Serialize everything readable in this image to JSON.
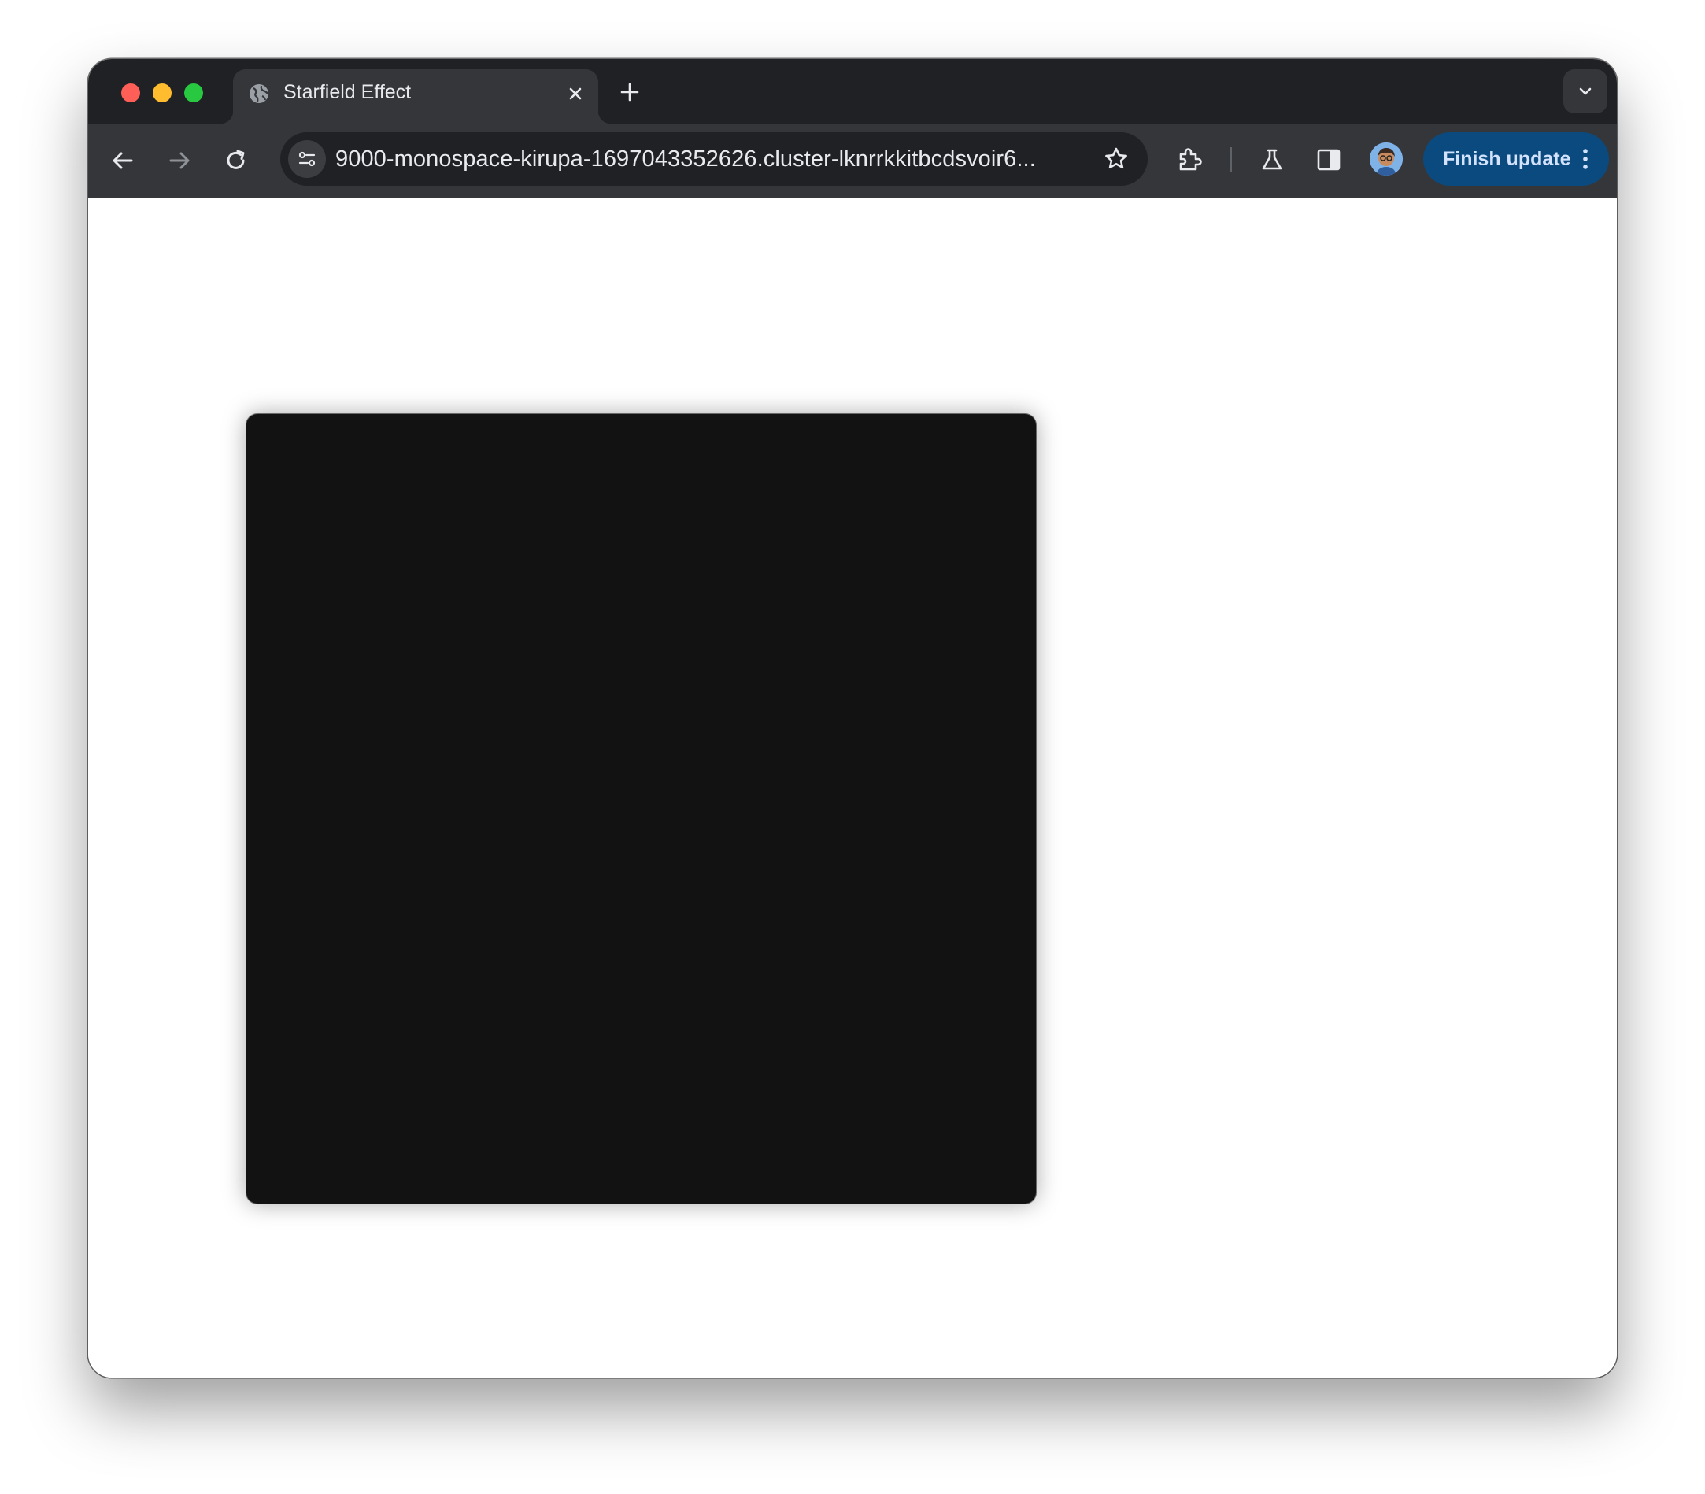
{
  "browser": {
    "tab": {
      "title": "Starfield Effect",
      "favicon": "globe-icon"
    },
    "address_bar": {
      "url": "9000-monospace-kirupa-1697043352626.cluster-lknrrkkitbcdsvoir6..."
    },
    "update_button": {
      "label": "Finish update"
    },
    "icons": {
      "back": "arrow-left-icon",
      "forward": "arrow-right-icon",
      "reload": "reload-icon",
      "site_info": "tune-icon",
      "bookmark": "star-icon",
      "extensions": "puzzle-icon",
      "labs": "flask-icon",
      "side_panel": "side-panel-icon",
      "profile": "avatar",
      "menu": "kebab-icon",
      "tab_search": "chevron-down-icon",
      "new_tab": "plus-icon",
      "close_tab": "close-icon"
    },
    "colors": {
      "frame": "#202124",
      "toolbar": "#35363a",
      "update_button": "#0b4a7e",
      "update_text": "#d3e3fd"
    }
  },
  "page": {
    "canvas": {
      "background": "#121212"
    }
  }
}
